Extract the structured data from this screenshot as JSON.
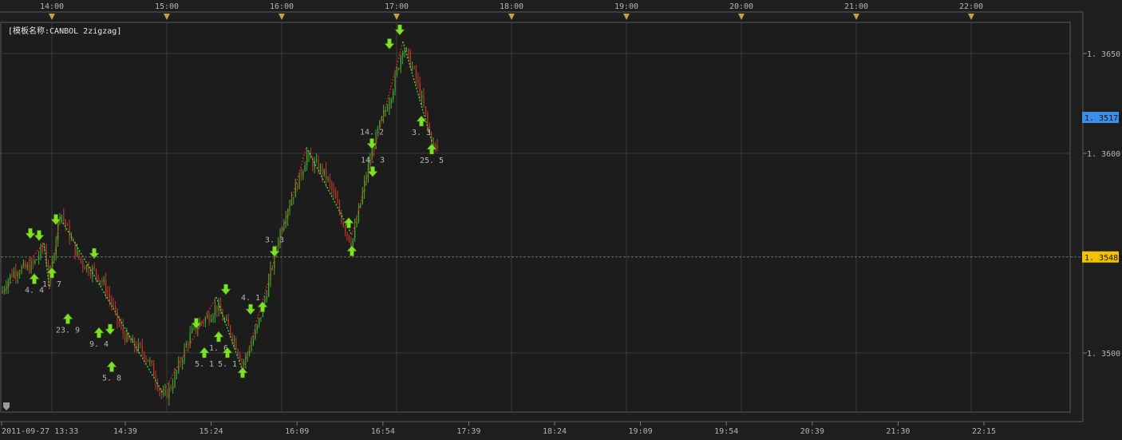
{
  "title_text": "[模板名称:CANBOL 2zigzag]",
  "colors": {
    "background": "#1e1e1e",
    "plot_background": "#1c1c1c",
    "grid": "#3a3a3a",
    "axis_text": "#b4b4b4",
    "bull_candle": "#3fae2a",
    "bear_candle": "#c0392b",
    "zigzag_up": "#d42020",
    "zigzag_down": "#3cd43c",
    "arrow": "#7fe02a",
    "current_price_badge": "#3a8fe8",
    "ref_price_badge": "#f2c200",
    "triangle_marker": "#c8a040"
  },
  "chart_data": {
    "type": "candlestick",
    "title": "[模板名称:CANBOL 2zigzag]",
    "ylim": [
      1.3465,
      1.368
    ],
    "y_ticks": [
      {
        "value": 1.35,
        "label": "1.3500"
      },
      {
        "value": 1.36,
        "label": "1.3600"
      },
      {
        "value": 1.365,
        "label": "1.3650"
      }
    ],
    "current_price": {
      "value": 1.35178,
      "label": "1.35178"
    },
    "reference_price": {
      "value": 1.35481,
      "label": "1.35481"
    },
    "top_time_ticks": [
      "14:00",
      "15:00",
      "16:00",
      "17:00",
      "18:00",
      "19:00",
      "20:00",
      "21:00",
      "22:00"
    ],
    "bottom_time_ticks": [
      "2011-09-27 13:33",
      "14:39",
      "15:24",
      "16:09",
      "16:54",
      "17:39",
      "18:24",
      "19:09",
      "19:54",
      "20:39",
      "21:30",
      "22:15"
    ],
    "zigzag_points": [
      {
        "t": "13:33",
        "v": 1.353
      },
      {
        "t": "14:25",
        "v": 1.3555
      },
      {
        "t": "14:32",
        "v": 1.3532
      },
      {
        "t": "14:45",
        "v": 1.3568
      },
      {
        "t": "16:54",
        "v": 1.348
      },
      {
        "t": "18:01",
        "v": 1.3528
      },
      {
        "t": "18:34",
        "v": 1.3491
      },
      {
        "t": "19:54",
        "v": 1.3603
      },
      {
        "t": "20:51",
        "v": 1.3559
      },
      {
        "t": "21:55",
        "v": 1.3656
      },
      {
        "t": "22:31",
        "v": 1.3606
      }
    ],
    "signals": [
      {
        "t": "14:08",
        "v": 1.356,
        "dir": "down",
        "label": ""
      },
      {
        "t": "14:19",
        "v": 1.3559,
        "dir": "down",
        "label": ""
      },
      {
        "t": "14:13",
        "v": 1.3537,
        "dir": "up",
        "label": "4.4"
      },
      {
        "t": "14:35",
        "v": 1.354,
        "dir": "up",
        "label": "1.7"
      },
      {
        "t": "14:40",
        "v": 1.3567,
        "dir": "down",
        "label": ""
      },
      {
        "t": "14:55",
        "v": 1.3517,
        "dir": "up",
        "label": "23.9"
      },
      {
        "t": "15:28",
        "v": 1.355,
        "dir": "down",
        "label": ""
      },
      {
        "t": "15:34",
        "v": 1.351,
        "dir": "up",
        "label": "9.4"
      },
      {
        "t": "15:48",
        "v": 1.3512,
        "dir": "down",
        "label": ""
      },
      {
        "t": "15:50",
        "v": 1.3493,
        "dir": "up",
        "label": "5.8"
      },
      {
        "t": "17:36",
        "v": 1.3515,
        "dir": "down",
        "label": ""
      },
      {
        "t": "17:46",
        "v": 1.35,
        "dir": "up",
        "label": "5.1"
      },
      {
        "t": "18:04",
        "v": 1.3508,
        "dir": "up",
        "label": "1.6"
      },
      {
        "t": "18:13",
        "v": 1.3532,
        "dir": "down",
        "label": ""
      },
      {
        "t": "18:15",
        "v": 1.35,
        "dir": "up",
        "label": "5.1"
      },
      {
        "t": "18:34",
        "v": 1.349,
        "dir": "up",
        "label": ""
      },
      {
        "t": "18:44",
        "v": 1.3522,
        "dir": "down",
        "label": "4.1"
      },
      {
        "t": "18:59",
        "v": 1.3523,
        "dir": "up",
        "label": ""
      },
      {
        "t": "19:14",
        "v": 1.3551,
        "dir": "down",
        "label": "3.3"
      },
      {
        "t": "20:47",
        "v": 1.3565,
        "dir": "up",
        "label": ""
      },
      {
        "t": "20:51",
        "v": 1.3551,
        "dir": "up",
        "label": ""
      },
      {
        "t": "21:16",
        "v": 1.3605,
        "dir": "down",
        "label": "14.2"
      },
      {
        "t": "21:17",
        "v": 1.3591,
        "dir": "down",
        "label": "14.3"
      },
      {
        "t": "21:38",
        "v": 1.3655,
        "dir": "down",
        "label": ""
      },
      {
        "t": "21:51",
        "v": 1.3662,
        "dir": "down",
        "label": ""
      },
      {
        "t": "22:18",
        "v": 1.3616,
        "dir": "up",
        "label": "3.3"
      },
      {
        "t": "22:31",
        "v": 1.3602,
        "dir": "up",
        "label": "25.5"
      }
    ]
  }
}
